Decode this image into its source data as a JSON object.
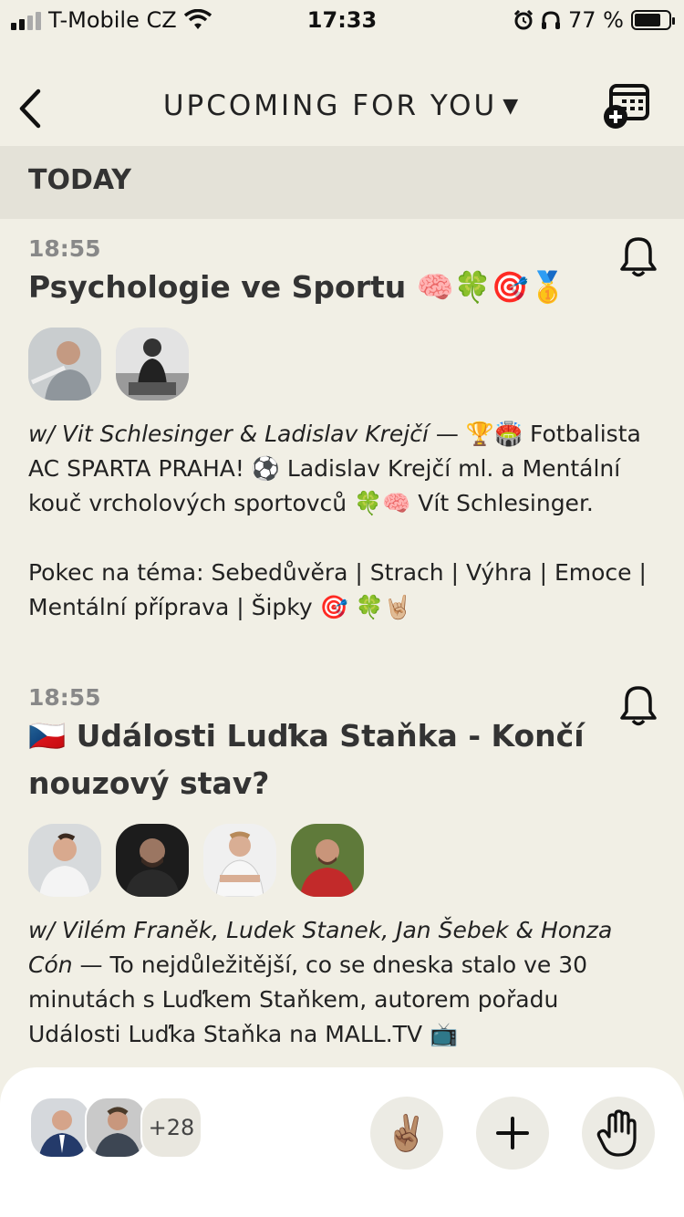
{
  "status_bar": {
    "carrier": "T-Mobile CZ",
    "time": "17:33",
    "battery_percent": "77 %",
    "battery_level": 0.77
  },
  "nav": {
    "title": "UPCOMING FOR YOU",
    "caret": "▼",
    "icons": {
      "back": "chevron-left-icon",
      "calendar_add": "calendar-plus-icon"
    }
  },
  "section": {
    "label": "TODAY"
  },
  "events": [
    {
      "time": "18:55",
      "title": "Psychologie ve Sportu 🧠🍀🎯🥇",
      "hosts_prefix": "w/ Vit Schlesinger & Ladislav Krejčí",
      "description": " — 🏆🏟️ Fotbalista AC SPARTA PRAHA! ⚽ Ladislav Krejčí ml. a Mentální kouč vrcholových sportovců 🍀🧠 Vít Schlesinger.\n\nPokec na téma: Sebedůvěra | Strach | Výhra | Emoce | Mentální příprava | Šipky 🎯 🍀🤘🏼"
    },
    {
      "time": "18:55",
      "title": "🇨🇿 Události Luďka Staňka - Končí nouzový stav?",
      "hosts_prefix": "w/ Vilém Franěk, Ludek Stanek, Jan Šebek & Honza Cón",
      "description": " — To nejdůležitější, co se dneska stalo ve 30 minutách s Luďkem Staňkem, autorem pořadu Události Luďka Staňka na MALL.TV 📺"
    }
  ],
  "bottom_bar": {
    "more_count": "+28",
    "raise_hand_emoji": "✌🏽",
    "icons": {
      "add": "plus-icon",
      "hand": "hand-icon"
    }
  },
  "colors": {
    "background": "#f1efe5",
    "section": "#e4e2d8",
    "text": "#222222"
  }
}
